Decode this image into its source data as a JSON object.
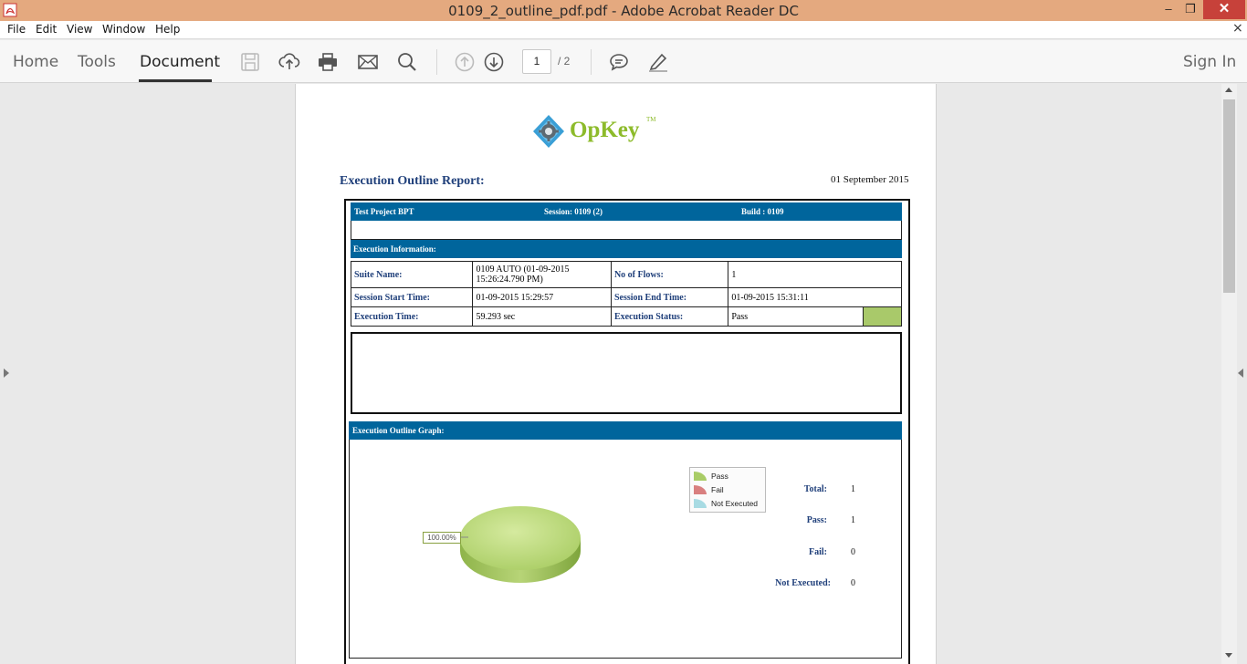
{
  "window": {
    "title": "0109_2_outline_pdf.pdf - Adobe Acrobat Reader DC",
    "minimize": "‒",
    "restore": "❐",
    "close": "✕"
  },
  "menu": {
    "items": [
      "File",
      "Edit",
      "View",
      "Window",
      "Help"
    ],
    "close_doc": "×"
  },
  "toolbar": {
    "tabs": [
      "Home",
      "Tools",
      "Document"
    ],
    "active_tab": "Document",
    "current_page": "1",
    "total_pages": "/ 2",
    "sign_in": "Sign In",
    "icons": [
      "save-icon",
      "upload-icon",
      "print-icon",
      "email-icon",
      "search-icon",
      "page-up-icon",
      "page-down-icon",
      "comment-icon",
      "highlight-pen-icon"
    ]
  },
  "document": {
    "logo_text": "OpKey",
    "logo_tm": "TM",
    "report_title": "Execution Outline Report:",
    "report_date": "01 September 2015",
    "header_band": {
      "project": "Test Project BPT",
      "session": "Session:  0109 (2)",
      "build": "Build :     0109"
    },
    "execution_info_title": "Execution Information:",
    "info_rows": [
      {
        "label1": "Suite Name:",
        "value1": "0109 AUTO (01-09-2015 15:26:24.790 PM)",
        "label2": "No of Flows:",
        "value2": "1"
      },
      {
        "label1": "Session Start Time:",
        "value1": "01-09-2015 15:29:57",
        "label2": "Session End Time:",
        "value2": "01-09-2015 15:31:11"
      },
      {
        "label1": "Execution Time:",
        "value1": "59.293 sec",
        "label2": "Execution Status:",
        "value2": "Pass"
      }
    ],
    "status_color": "#a9c96a",
    "graph_title": "Execution  Outline Graph:",
    "legend": [
      {
        "label": "Pass",
        "color": "#a9cc66"
      },
      {
        "label": "Fail",
        "color": "#d98080"
      },
      {
        "label": "Not Executed",
        "color": "#a8dbe3"
      }
    ],
    "pie_label": "100.00%",
    "stats": [
      {
        "label": "Total:",
        "value": "1"
      },
      {
        "label": "Pass:",
        "value": "1"
      },
      {
        "label": "Fail:",
        "value": "0"
      },
      {
        "label": "Not Executed:",
        "value": "0"
      }
    ]
  },
  "chart_data": {
    "type": "pie",
    "categories": [
      "Pass",
      "Fail",
      "Not Executed"
    ],
    "values": [
      1,
      0,
      0
    ],
    "labels": [
      "100.00%"
    ]
  }
}
